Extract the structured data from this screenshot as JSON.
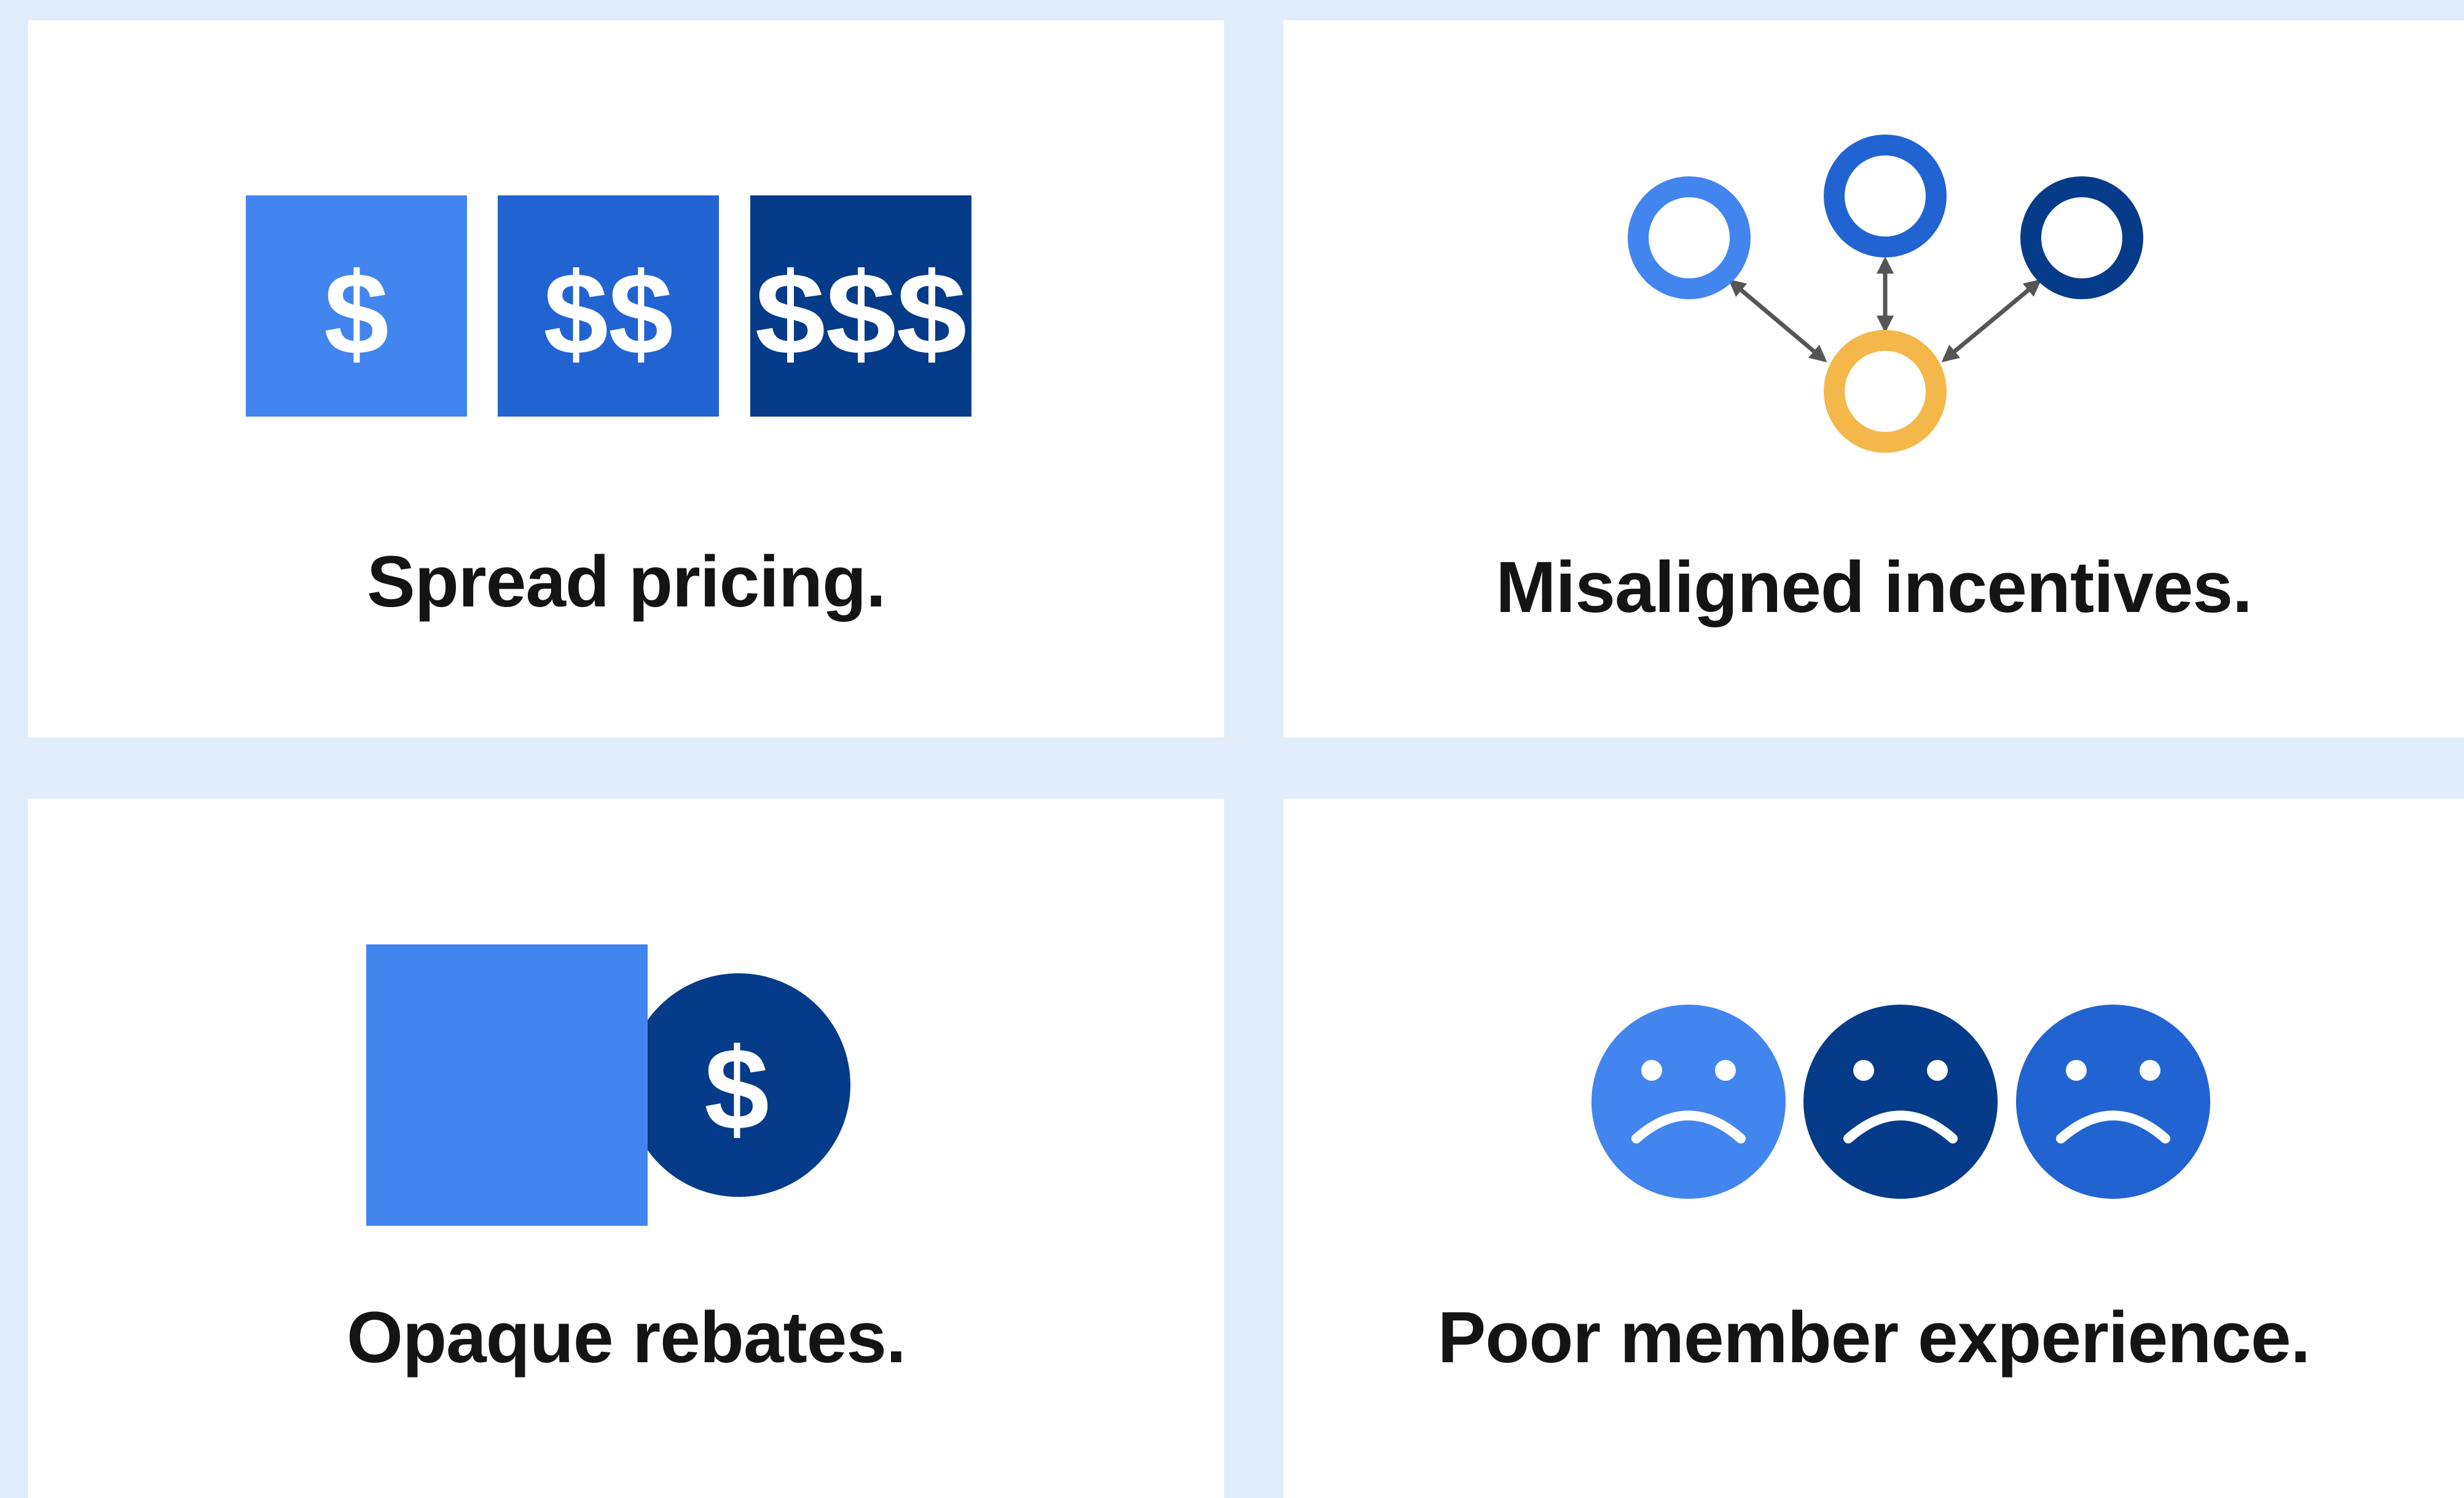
{
  "cards": {
    "spread": {
      "caption": "Spread pricing.",
      "tiles": [
        {
          "label": "$",
          "color": "#4285ee"
        },
        {
          "label": "$$",
          "color": "#2164d1"
        },
        {
          "label": "$$$",
          "color": "#053b88"
        }
      ]
    },
    "misaligned": {
      "caption": "Misaligned incentives.",
      "node_colors": [
        "#4285ee",
        "#2164d1",
        "#053b88",
        "#f4b84a"
      ],
      "arrow_color": "#555555"
    },
    "rebates": {
      "caption": "Opaque rebates.",
      "square_color": "#4285ee",
      "coin_color": "#053b88",
      "coin_label": "$"
    },
    "member": {
      "caption": "Poor member experience.",
      "face_colors": [
        "#4285ee",
        "#053b88",
        "#2164d1"
      ]
    }
  },
  "colors": {
    "background": "#e2edfc",
    "card": "#ffffff",
    "text": "#141414"
  }
}
